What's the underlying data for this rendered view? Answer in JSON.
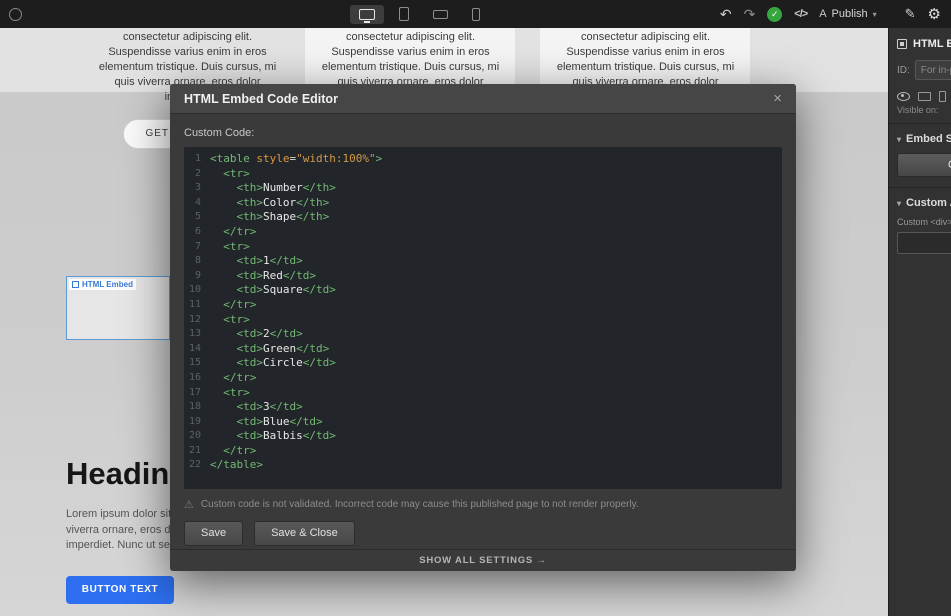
{
  "icons": {
    "undo": "↶",
    "redo": "↷",
    "check": "✓",
    "code_tag": "</>",
    "publish_glyph": "A",
    "caret_down": "▾",
    "brush": "✎",
    "gear": "⚙",
    "close": "×",
    "warning": "⚠"
  },
  "colors": {
    "accent_blue": "#2d6ff0",
    "embed_outline_blue": "#5b9bd5",
    "saved_check_green": "#36a63f",
    "syntax_tag_green": "#74b874",
    "syntax_attr_orange": "#e0973c",
    "syntax_string_orange": "#d19a47"
  },
  "toolbar": {
    "publish_label": "Publish"
  },
  "sidebar": {
    "element_title": "HTML Embed",
    "id_label": "ID:",
    "id_placeholder": "For in-page links",
    "visible_on_label": "Visible on:",
    "embed_settings_label": "Embed Settings",
    "open_button_label": "Open Code Editor",
    "custom_attrs_label": "Custom Attributes",
    "custom_div_label": "Custom <div> attributes"
  },
  "page": {
    "columns": [
      "consectetur adipiscing elit. Suspendisse varius enim in eros elementum tristique. Duis cursus, mi quis viverra ornare, eros dolor interdum.",
      "consectetur adipiscing elit. Suspendisse varius enim in eros elementum tristique. Duis cursus, mi quis viverra ornare, eros dolor interdum.",
      "consectetur adipiscing elit. Suspendisse varius enim in eros elementum tristique. Duis cursus, mi quis viverra ornare, eros dolor interdum."
    ],
    "get_in_touch_label": "GET IN TOUCH",
    "embed_element_label": "HTML Embed",
    "heading": "Heading",
    "paragraph_lines": [
      "Lorem ipsum dolor sit amet, consectetur",
      "viverra ornare, eros dolor sit amet",
      "imperdiet. Nunc ut sem vitae risus"
    ],
    "button_label": "BUTTON TEXT"
  },
  "modal": {
    "title": "HTML Embed Code Editor",
    "custom_code_label": "Custom Code:",
    "code": {
      "lines": [
        [
          [
            "tag",
            "<table "
          ],
          [
            "attr",
            "style"
          ],
          [
            "eq",
            "="
          ],
          [
            "str",
            "\"width:100%\""
          ],
          [
            "tag",
            ">"
          ]
        ],
        [
          [
            "tag",
            "  <tr>"
          ]
        ],
        [
          [
            "tag",
            "    <th>"
          ],
          [
            "txt",
            "Number"
          ],
          [
            "tag",
            "</th>"
          ]
        ],
        [
          [
            "tag",
            "    <th>"
          ],
          [
            "txt",
            "Color"
          ],
          [
            "tag",
            "</th>"
          ]
        ],
        [
          [
            "tag",
            "    <th>"
          ],
          [
            "txt",
            "Shape"
          ],
          [
            "tag",
            "</th>"
          ]
        ],
        [
          [
            "tag",
            "  </tr>"
          ]
        ],
        [
          [
            "tag",
            "  <tr>"
          ]
        ],
        [
          [
            "tag",
            "    <td>"
          ],
          [
            "txt",
            "1"
          ],
          [
            "tag",
            "</td>"
          ]
        ],
        [
          [
            "tag",
            "    <td>"
          ],
          [
            "txt",
            "Red"
          ],
          [
            "tag",
            "</td>"
          ]
        ],
        [
          [
            "tag",
            "    <td>"
          ],
          [
            "txt",
            "Square"
          ],
          [
            "tag",
            "</td>"
          ]
        ],
        [
          [
            "tag",
            "  </tr>"
          ]
        ],
        [
          [
            "tag",
            "  <tr>"
          ]
        ],
        [
          [
            "tag",
            "    <td>"
          ],
          [
            "txt",
            "2"
          ],
          [
            "tag",
            "</td>"
          ]
        ],
        [
          [
            "tag",
            "    <td>"
          ],
          [
            "txt",
            "Green"
          ],
          [
            "tag",
            "</td>"
          ]
        ],
        [
          [
            "tag",
            "    <td>"
          ],
          [
            "txt",
            "Circle"
          ],
          [
            "tag",
            "</td>"
          ]
        ],
        [
          [
            "tag",
            "  </tr>"
          ]
        ],
        [
          [
            "tag",
            "  <tr>"
          ]
        ],
        [
          [
            "tag",
            "    <td>"
          ],
          [
            "txt",
            "3"
          ],
          [
            "tag",
            "</td>"
          ]
        ],
        [
          [
            "tag",
            "    <td>"
          ],
          [
            "txt",
            "Blue"
          ],
          [
            "tag",
            "</td>"
          ]
        ],
        [
          [
            "tag",
            "    <td>"
          ],
          [
            "txt",
            "Balbis"
          ],
          [
            "tag",
            "</td>"
          ]
        ],
        [
          [
            "tag",
            "  </tr>"
          ]
        ],
        [
          [
            "tag",
            "</table>"
          ]
        ]
      ]
    },
    "warning": "Custom code is not validated. Incorrect code may cause this published page to not render properly.",
    "save_label": "Save",
    "save_close_label": "Save & Close",
    "show_all_label": "SHOW ALL SETTINGS →"
  }
}
